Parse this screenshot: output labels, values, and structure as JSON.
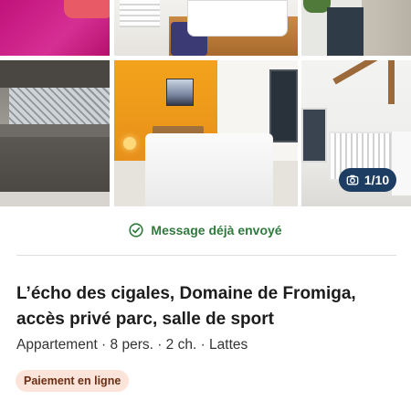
{
  "gallery": {
    "photo_counter": "1/10",
    "photos": [
      {
        "name": "photo-bedroom-pink"
      },
      {
        "name": "photo-bathroom-sink"
      },
      {
        "name": "photo-entrance-door"
      },
      {
        "name": "photo-kitchen"
      },
      {
        "name": "photo-bedroom-orange-wall"
      },
      {
        "name": "photo-baby-room"
      }
    ]
  },
  "status": {
    "message_sent": "Message déjà envoyé",
    "icon": "check-circle-icon",
    "color": "#2e7a3b"
  },
  "listing": {
    "title": "L’écho des cigales, Domaine de Fromiga, accès privé parc, salle de sport",
    "meta": "Appartement · 8 pers. · 2 ch. · Lattes",
    "badge": "Paiement en ligne"
  },
  "colors": {
    "badge_bg": "#fde4da",
    "badge_text": "#6a2e14",
    "counter_bg": "#1e3d63"
  }
}
